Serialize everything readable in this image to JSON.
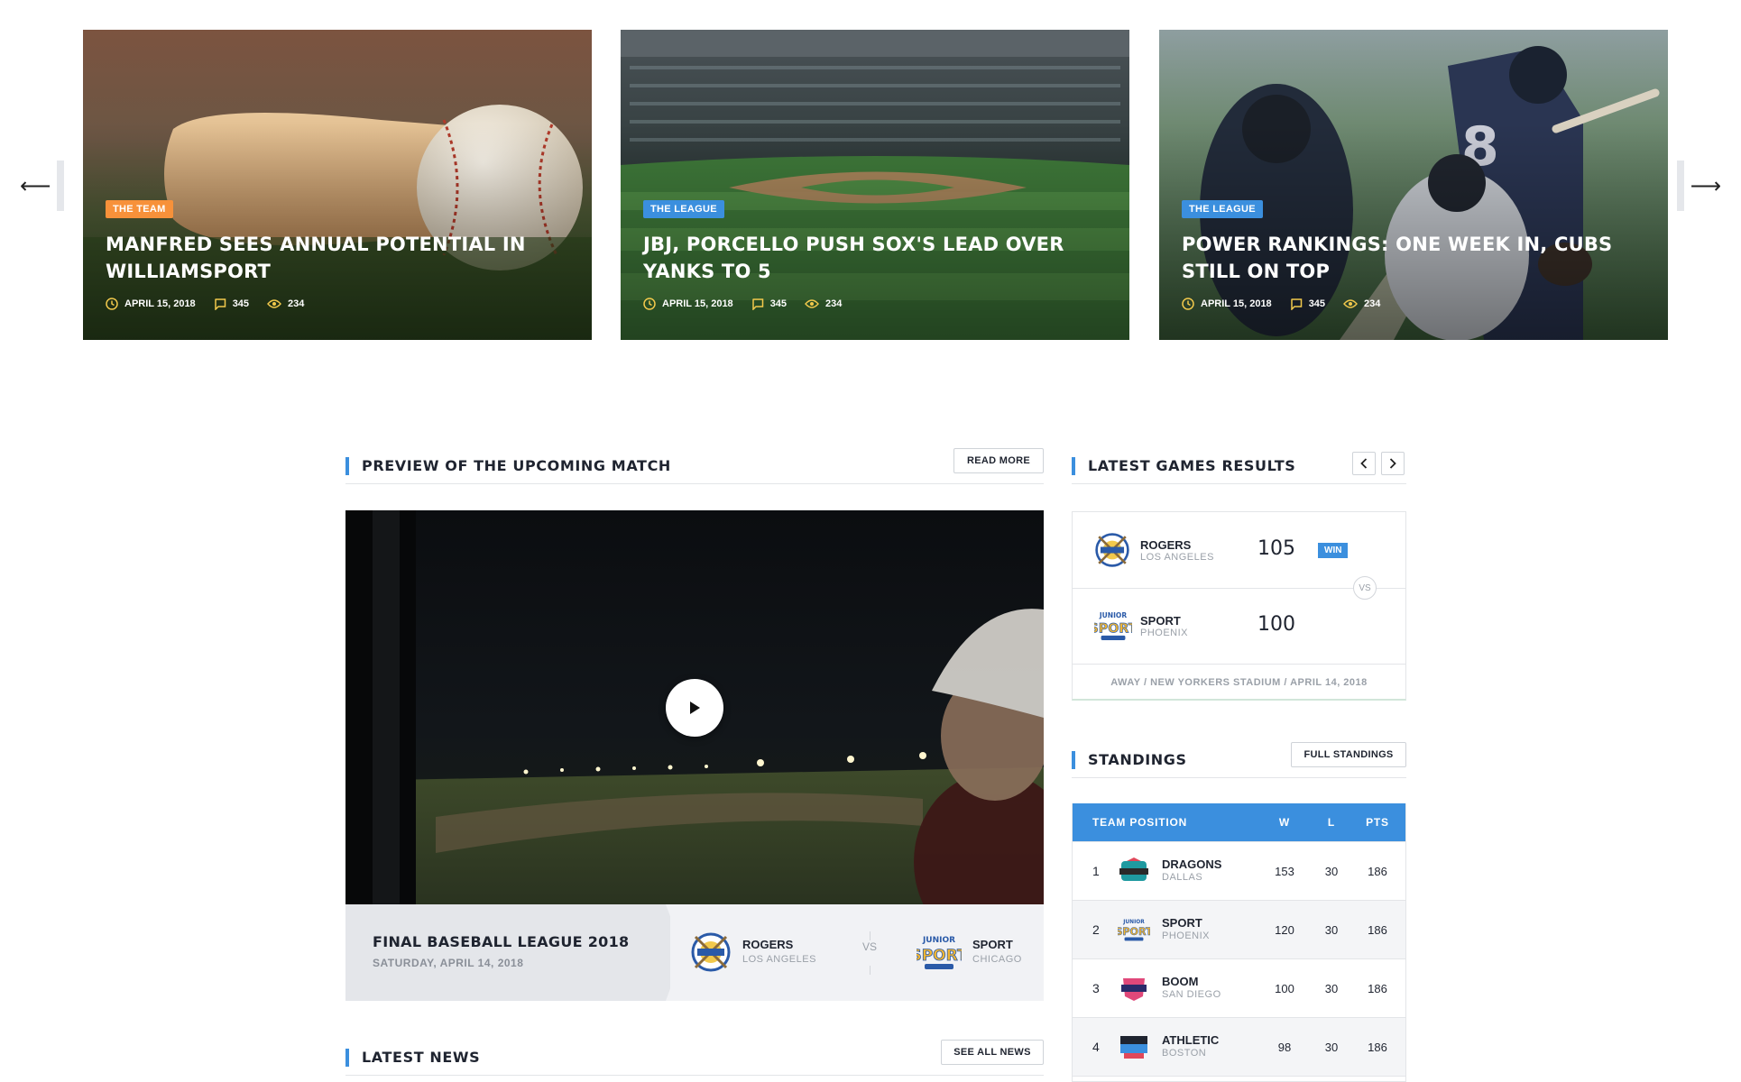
{
  "slider": {
    "prev_glyph": "⟵",
    "next_glyph": "⟶",
    "cards": [
      {
        "tag": "THE TEAM",
        "tag_color": "#f7913a",
        "title": "MANFRED SEES ANNUAL POTENTIAL IN WILLIAMSPORT",
        "date": "APRIL 15, 2018",
        "comments": "345",
        "views": "234"
      },
      {
        "tag": "THE LEAGUE",
        "tag_color": "#3b8fde",
        "title": "JBJ, PORCELLO PUSH SOX'S LEAD OVER YANKS TO 5",
        "date": "APRIL 15, 2018",
        "comments": "345",
        "views": "234"
      },
      {
        "tag": "THE LEAGUE",
        "tag_color": "#3b8fde",
        "title": "POWER RANKINGS: ONE WEEK IN, CUBS STILL ON TOP",
        "date": "APRIL 15, 2018",
        "comments": "345",
        "views": "234"
      }
    ]
  },
  "preview": {
    "title": "PREVIEW OF THE UPCOMING MATCH",
    "button": "READ MORE",
    "match_title": "FINAL BASEBALL LEAGUE 2018",
    "match_date": "SATURDAY, APRIL 14, 2018",
    "home": {
      "name": "ROGERS",
      "city": "LOS ANGELES"
    },
    "vs": "VS",
    "away": {
      "name": "SPORT",
      "city": "CHICAGO"
    }
  },
  "results": {
    "title": "LATEST GAMES RESULTS",
    "team1": {
      "name": "ROGERS",
      "city": "LOS ANGELES",
      "score": "105",
      "badge": "WIN"
    },
    "vs": "VS",
    "team2": {
      "name": "SPORT",
      "city": "PHOENIX",
      "score": "100"
    },
    "footer": "AWAY / NEW YORKERS STADIUM / APRIL 14, 2018"
  },
  "standings": {
    "title": "STANDINGS",
    "button": "FULL STANDINGS",
    "headers": {
      "team": "TEAM POSITION",
      "w": "W",
      "l": "L",
      "pts": "PTS"
    },
    "rows": [
      {
        "pos": "1",
        "name": "DRAGONS",
        "city": "DALLAS",
        "w": "153",
        "l": "30",
        "pts": "186"
      },
      {
        "pos": "2",
        "name": "SPORT",
        "city": "PHOENIX",
        "w": "120",
        "l": "30",
        "pts": "186"
      },
      {
        "pos": "3",
        "name": "BOOM",
        "city": "SAN DIEGO",
        "w": "100",
        "l": "30",
        "pts": "186"
      },
      {
        "pos": "4",
        "name": "ATHLETIC",
        "city": "BOSTON",
        "w": "98",
        "l": "30",
        "pts": "186"
      }
    ]
  },
  "latest_news": {
    "title": "LATEST NEWS",
    "button": "SEE ALL NEWS"
  },
  "colors": {
    "accent": "#3b8fde",
    "orange": "#f7913a",
    "meta_icon": "#f2c94c"
  }
}
